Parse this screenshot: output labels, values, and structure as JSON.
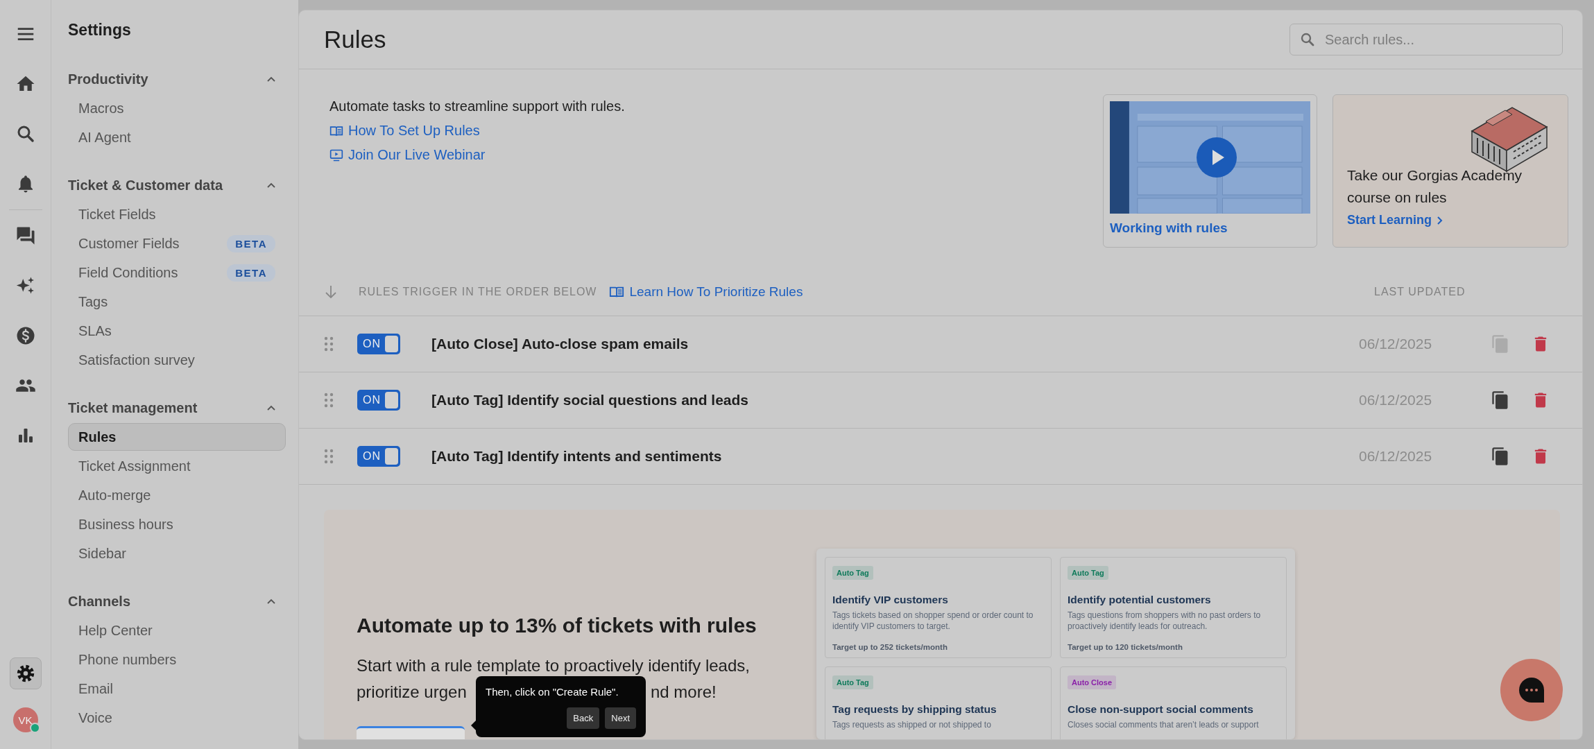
{
  "rail": {
    "items": [
      {
        "kind": "menu",
        "selected": false
      },
      {
        "kind": "home",
        "selected": false
      },
      {
        "kind": "search",
        "selected": false
      },
      {
        "kind": "bell",
        "selected": false
      },
      {
        "kind": "chat",
        "selected": false
      },
      {
        "kind": "sparkles",
        "selected": false
      },
      {
        "kind": "dollar",
        "selected": false
      },
      {
        "kind": "people",
        "selected": false
      },
      {
        "kind": "chart",
        "selected": false
      }
    ],
    "bottom": [
      {
        "kind": "gear",
        "selected": true
      }
    ],
    "avatar": {
      "initials": "VK",
      "online": true
    }
  },
  "sidebar": {
    "title": "Settings",
    "sections": [
      {
        "title": "Productivity",
        "expanded": true,
        "items": [
          {
            "label": "Macros",
            "selected": false
          },
          {
            "label": "AI Agent",
            "selected": false
          }
        ]
      },
      {
        "title": "Ticket & Customer data",
        "expanded": true,
        "items": [
          {
            "label": "Ticket Fields",
            "selected": false
          },
          {
            "label": "Customer Fields",
            "selected": false,
            "badge": "BETA"
          },
          {
            "label": "Field Conditions",
            "selected": false,
            "badge": "BETA"
          },
          {
            "label": "Tags",
            "selected": false
          },
          {
            "label": "SLAs",
            "selected": false
          },
          {
            "label": "Satisfaction survey",
            "selected": false
          }
        ]
      },
      {
        "title": "Ticket management",
        "expanded": true,
        "items": [
          {
            "label": "Rules",
            "selected": true
          },
          {
            "label": "Ticket Assignment",
            "selected": false
          },
          {
            "label": "Auto-merge",
            "selected": false
          },
          {
            "label": "Business hours",
            "selected": false
          },
          {
            "label": "Sidebar",
            "selected": false
          }
        ]
      },
      {
        "title": "Channels",
        "expanded": true,
        "items": [
          {
            "label": "Help Center",
            "selected": false
          },
          {
            "label": "Phone numbers",
            "selected": false
          },
          {
            "label": "Email",
            "selected": false
          },
          {
            "label": "Voice",
            "selected": false
          }
        ]
      }
    ]
  },
  "page": {
    "title": "Rules",
    "search": {
      "placeholder": "Search rules..."
    }
  },
  "intro": {
    "text": "Automate tasks to streamline support with rules.",
    "links": [
      {
        "label": "How To Set Up Rules",
        "kind": "book"
      },
      {
        "label": "Join Our Live Webinar",
        "kind": "video"
      }
    ]
  },
  "video_card": {
    "caption": "Working with rules"
  },
  "academy_card": {
    "text": "Take our Gorgias Academy course on rules",
    "link": "Start Learning"
  },
  "rules_table": {
    "order_label": "RULES TRIGGER IN THE ORDER BELOW",
    "help_link": "Learn How To Prioritize Rules",
    "column": "LAST UPDATED",
    "rows": [
      {
        "toggle_label": "ON",
        "on": true,
        "name": "[Auto Close] Auto-close spam emails",
        "updated": "06/12/2025",
        "duplicate_disabled": true
      },
      {
        "toggle_label": "ON",
        "on": true,
        "name": "[Auto Tag] Identify social questions and leads",
        "updated": "06/12/2025",
        "duplicate_disabled": false
      },
      {
        "toggle_label": "ON",
        "on": true,
        "name": "[Auto Tag] Identify intents and sentiments",
        "updated": "06/12/2025",
        "duplicate_disabled": false
      }
    ]
  },
  "promo": {
    "heading": "Automate up to 13% of tickets with rules",
    "text_lines": [
      "Start with a rule template to proactively identify leads,",
      "prioritize urgen",
      "nd more!"
    ],
    "templates": [
      {
        "tag": "Auto Tag",
        "color": "#0e7a5a",
        "title": "Identify VIP customers",
        "description": "Tags tickets based on shopper spend or order count to identify VIP customers to target.",
        "target": "Target up to 252 tickets/month"
      },
      {
        "tag": "Auto Tag",
        "color": "#0e7a5a",
        "title": "Identify potential customers",
        "description": "Tags questions from shoppers with no past orders to proactively identify leads for outreach.",
        "target": "Target up to 120 tickets/month"
      },
      {
        "tag": "Auto Tag",
        "color": "#0e7a5a",
        "title": "Tag requests by shipping status",
        "description": "Tags requests as shipped or not shipped to"
      },
      {
        "tag": "Auto Close",
        "color": "#8a1fa8",
        "title": "Close non-support social comments",
        "description": "Closes social comments that aren’t leads or support"
      }
    ]
  },
  "tour_tooltip": {
    "text": "Then, click on \"Create Rule\".",
    "buttons": [
      "Back",
      "Next"
    ]
  }
}
